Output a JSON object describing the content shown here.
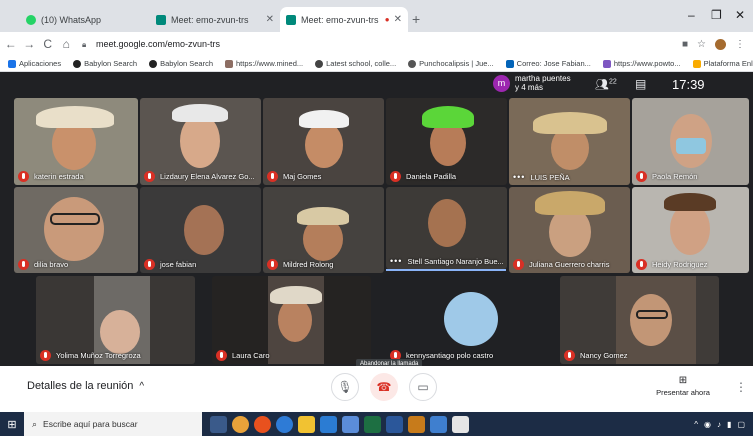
{
  "browser": {
    "tabs": [
      {
        "title": "(10) WhatsApp",
        "active": false,
        "favicon_color": "#25d366"
      },
      {
        "title": "Meet: emo-zvun-trs",
        "active": false,
        "favicon_color": "#00897b"
      },
      {
        "title": "Meet: emo-zvun-trs",
        "active": true,
        "favicon_color": "#00897b"
      }
    ],
    "url": "meet.google.com/emo-zvun-trs",
    "bookmarks": [
      {
        "label": "Aplicaciones",
        "color": "#1a73e8"
      },
      {
        "label": "Babylon Search",
        "color": "#222"
      },
      {
        "label": "Babylon Search",
        "color": "#222"
      },
      {
        "label": "https://www.mined...",
        "color": "#8d6e63"
      },
      {
        "label": "Latest school, colle...",
        "color": "#444"
      },
      {
        "label": "Punchocalipsis | Jue...",
        "color": "#555"
      },
      {
        "label": "Correo: Jose Fabian...",
        "color": "#0364b8"
      },
      {
        "label": "https://www.powto...",
        "color": "#7e57c2"
      },
      {
        "label": "Plataforma Enlace",
        "color": "#f9ab00"
      }
    ]
  },
  "meet": {
    "host_initial": "m",
    "host_name": "martha puentes",
    "host_sub": "y 4 más",
    "participant_count": "22",
    "time": "17:39",
    "self_label": "Tú",
    "participants": [
      {
        "name": "katerin estrada",
        "muted": true
      },
      {
        "name": "Lizdaury Elena Alvarez Go...",
        "muted": true
      },
      {
        "name": "Maj Gomes",
        "muted": true
      },
      {
        "name": "Daniela Padilla",
        "muted": true
      },
      {
        "name": "LUIS PEÑA",
        "muted": false
      },
      {
        "name": "Paola Remón",
        "muted": true
      },
      {
        "name": "dilia bravo",
        "muted": true
      },
      {
        "name": "jose fabian",
        "muted": true
      },
      {
        "name": "Mildred Rolong",
        "muted": true
      },
      {
        "name": "Stell Santiago Naranjo Bue...",
        "muted": false
      },
      {
        "name": "Juliana Guerrero charris",
        "muted": true
      },
      {
        "name": "Heidy Rodriguez",
        "muted": true
      },
      {
        "name": "Yolima Muñoz Torregroza",
        "muted": true
      },
      {
        "name": "Laura Caro",
        "muted": true
      },
      {
        "name": "kennysantiago polo castro",
        "muted": true
      },
      {
        "name": "Nancy Gomez",
        "muted": true
      }
    ],
    "tooltip": "Abandonar la llamada",
    "details_label": "Detalles de la reunión",
    "present_label": "Presentar ahora"
  },
  "taskbar": {
    "search_placeholder": "Escribe aquí para buscar"
  }
}
